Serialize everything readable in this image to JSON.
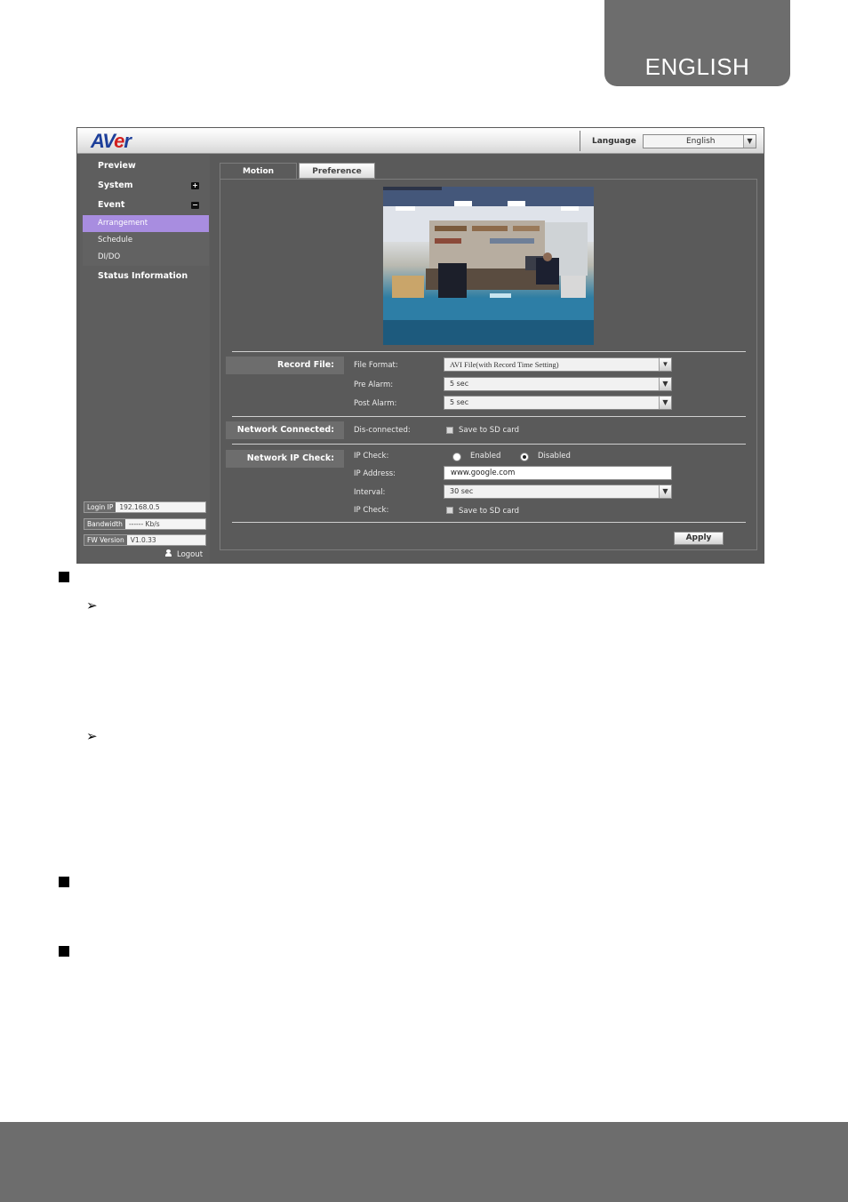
{
  "page": {
    "corner_tab": "ENGLISH"
  },
  "app": {
    "logo": {
      "prefix": "AV",
      "accent": "e",
      "suffix": "r"
    },
    "language": {
      "label": "Language",
      "value": "English"
    },
    "sidebar": {
      "preview": "Preview",
      "system": "System",
      "event": "Event",
      "event_items": [
        "Arrangement",
        "Schedule",
        "DI/DO"
      ],
      "status": "Status Information",
      "info": {
        "login_ip_key": "Login IP",
        "login_ip": "192.168.0.5",
        "bandwidth_key": "Bandwidth",
        "bandwidth": "------ Kb/s",
        "fw_key": "FW Version",
        "fw": "V1.0.33"
      },
      "logout": "Logout"
    },
    "tabs": {
      "motion": "Motion",
      "preference": "Preference"
    },
    "record": {
      "section": "Record File:",
      "file_format_label": "File Format:",
      "file_format": "AVI File(with Record Time Setting)",
      "pre_alarm_label": "Pre Alarm:",
      "pre_alarm": "5 sec",
      "post_alarm_label": "Post Alarm:",
      "post_alarm": "5 sec"
    },
    "network": {
      "section": "Network Connected:",
      "disconnected_label": "Dis-connected:",
      "save_sd": "Save to SD card"
    },
    "ip_check": {
      "section": "Network IP Check:",
      "ip_check_label": "IP Check:",
      "enabled": "Enabled",
      "disabled": "Disabled",
      "ip_address_label": "IP Address:",
      "ip_address": "www.google.com",
      "interval_label": "Interval:",
      "interval": "30 sec",
      "ip_check2_label": "IP Check:",
      "save_sd": "Save to SD card"
    },
    "apply": "Apply"
  },
  "colors": {
    "brand_blue": "#1d3f9a",
    "brand_red": "#d21f1f",
    "active_menu": "#a88de0",
    "page_gray": "#6d6d6d"
  }
}
